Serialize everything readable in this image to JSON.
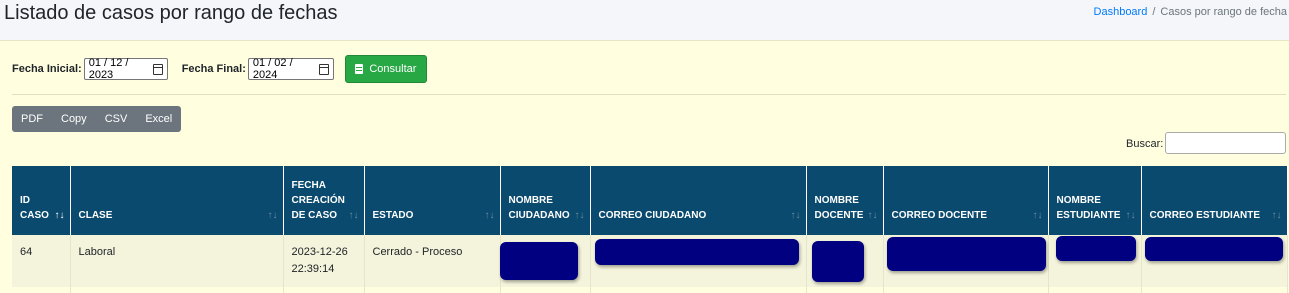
{
  "header": {
    "title": "Listado de casos por rango de fechas",
    "breadcrumb_home": "Dashboard",
    "breadcrumb_separator": "/",
    "breadcrumb_current": "Casos por rango de fecha"
  },
  "filters": {
    "start_label": "Fecha Inicial:",
    "start_value": "01 / 12 / 2023",
    "end_label": "Fecha Final:",
    "end_value": "01 / 02 / 2024",
    "submit_label": "Consultar",
    "submit_color": "#28a745"
  },
  "export_buttons": [
    "PDF",
    "Copy",
    "CSV",
    "Excel"
  ],
  "search": {
    "label": "Buscar:",
    "value": ""
  },
  "table": {
    "header_color": "#0a4a6e",
    "columns": [
      [
        "ID",
        "CASO"
      ],
      [
        "CLASE"
      ],
      [
        "FECHA",
        "CREACIÓN",
        "DE CASO"
      ],
      [
        "ESTADO"
      ],
      [
        "NOMBRE",
        "CIUDADANO"
      ],
      [
        "CORREO CIUDADANO"
      ],
      [
        "NOMBRE",
        "DOCENTE"
      ],
      [
        "CORREO DOCENTE"
      ],
      [
        "NOMBRE",
        "ESTUDIANTE"
      ],
      [
        "CORREO ESTUDIANTE"
      ]
    ],
    "rows": [
      {
        "id": "64",
        "clase": "Laboral",
        "fecha": "2023-12-26",
        "hora": "22:39:14",
        "estado": "Cerrado - Proceso",
        "redacted_color": "#000080"
      }
    ]
  }
}
